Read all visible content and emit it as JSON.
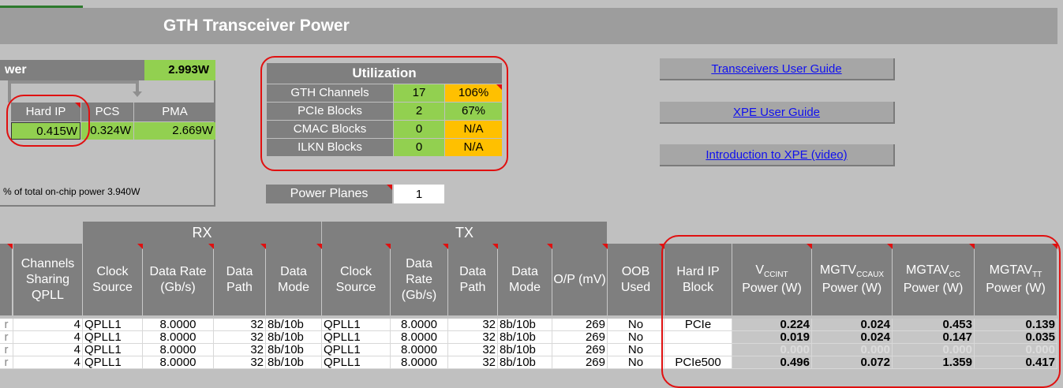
{
  "title": "GTH Transceiver Power",
  "power": {
    "header_label": "wer",
    "total": "2.993W",
    "breakdown": [
      {
        "label": "Hard IP",
        "value": "0.415W"
      },
      {
        "label": "PCS",
        "value": "0.324W"
      },
      {
        "label": "PMA",
        "value": "2.669W"
      }
    ],
    "note": "% of total on-chip power 3.940W"
  },
  "utilization": {
    "title": "Utilization",
    "rows": [
      {
        "label": "GTH Channels",
        "value": "17",
        "percent": "106%",
        "pct_color": "#ffc000"
      },
      {
        "label": "PCIe Blocks",
        "value": "2",
        "percent": "67%",
        "pct_color": "#92d050"
      },
      {
        "label": "CMAC Blocks",
        "value": "0",
        "percent": "N/A",
        "pct_color": "#ffc000"
      },
      {
        "label": "ILKN Blocks",
        "value": "0",
        "percent": "N/A",
        "pct_color": "#ffc000"
      }
    ]
  },
  "power_planes": {
    "label": "Power Planes",
    "value": "1"
  },
  "links": [
    {
      "label": "Transceivers User Guide"
    },
    {
      "label": "XPE User Guide"
    },
    {
      "label": "Introduction to XPE (video)"
    }
  ],
  "table": {
    "groups": {
      "rx": "RX",
      "tx": "TX"
    },
    "headers": {
      "channels_sharing": "Channels Sharing QPLL",
      "rx_clock": "Clock Source",
      "rx_rate": "Data Rate (Gb/s)",
      "rx_path": "Data Path",
      "rx_mode": "Data Mode",
      "tx_clock": "Clock Source",
      "tx_rate": "Data Rate (Gb/s)",
      "tx_path": "Data Path",
      "tx_mode": "Data Mode",
      "op": "O/P (mV)",
      "oob": "OOB Used",
      "hardip": "Hard IP Block"
    },
    "power_headers": [
      {
        "main": "V",
        "sub": "CCINT",
        "tail": "Power (W)"
      },
      {
        "main": "MGTV",
        "sub": "CCAUX",
        "tail": "Power (W)"
      },
      {
        "main": "MGTAV",
        "sub": "CC",
        "tail": "Power (W)"
      },
      {
        "main": "MGTAV",
        "sub": "TT",
        "tail": "Power (W)"
      }
    ],
    "rows": [
      {
        "lead": "r",
        "ch": "4",
        "rxclk": "QPLL1",
        "rxrate": "8.0000",
        "rxpath": "32",
        "rxmode": "8b/10b",
        "txclk": "QPLL1",
        "txrate": "8.0000",
        "txpath": "32",
        "txmode": "8b/10b",
        "op": "269",
        "oob": "No",
        "hip": "PCIe",
        "p1": "0.224",
        "p2": "0.024",
        "p3": "0.453",
        "p4": "0.139"
      },
      {
        "lead": "r",
        "ch": "4",
        "rxclk": "QPLL1",
        "rxrate": "8.0000",
        "rxpath": "32",
        "rxmode": "8b/10b",
        "txclk": "QPLL1",
        "txrate": "8.0000",
        "txpath": "32",
        "txmode": "8b/10b",
        "op": "269",
        "oob": "No",
        "hip": "",
        "p1": "0.019",
        "p2": "0.024",
        "p3": "0.147",
        "p4": "0.035"
      },
      {
        "lead": "r",
        "ch": "4",
        "rxclk": "QPLL1",
        "rxrate": "8.0000",
        "rxpath": "32",
        "rxmode": "8b/10b",
        "txclk": "QPLL1",
        "txrate": "8.0000",
        "txpath": "32",
        "txmode": "8b/10b",
        "op": "269",
        "oob": "No",
        "hip": "",
        "p1": "0.000",
        "p2": "0.000",
        "p3": "0.000",
        "p4": "0.000"
      },
      {
        "lead": "r",
        "ch": "4",
        "rxclk": "QPLL1",
        "rxrate": "8.0000",
        "rxpath": "32",
        "rxmode": "8b/10b",
        "txclk": "QPLL1",
        "txrate": "8.0000",
        "txpath": "32",
        "txmode": "8b/10b",
        "op": "269",
        "oob": "No",
        "hip": "PCIe500",
        "p1": "0.496",
        "p2": "0.072",
        "p3": "1.359",
        "p4": "0.417"
      }
    ]
  },
  "colors": {
    "accent_green": "#92d050",
    "warn_orange": "#ffc000",
    "header_gray": "#7f7f7f",
    "annotation_red": "#e01010",
    "link_blue": "#1010ee"
  }
}
